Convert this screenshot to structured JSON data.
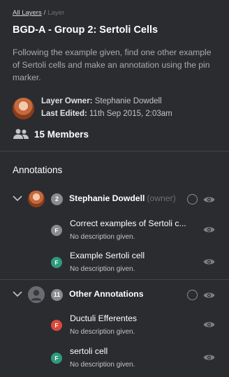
{
  "breadcrumb": {
    "root": "All Layers",
    "separator": "/",
    "current": "Layer"
  },
  "layer": {
    "title": "BGD-A - Group 2: Sertoli Cells",
    "description": "Following the example given, find one other example of Sertoli cells and make an annotation using the pin marker.",
    "owner_label": "Layer Owner:",
    "owner_name": "Stephanie Dowdell",
    "edited_label": "Last Edited:",
    "edited_value": "11th Sep 2015, 2:03am"
  },
  "members": {
    "label": "15 Members",
    "icon": "people-icon"
  },
  "annotations_heading": "Annotations",
  "colors": {
    "background": "#2b2c30",
    "divider": "#44454a",
    "badge_gray": "#8a8b8f",
    "badge_green": "#2e9b7c",
    "badge_red": "#d9493a"
  },
  "groups": [
    {
      "name": "Stephanie Dowdell",
      "role": "(owner)",
      "count": "2",
      "items": [
        {
          "letter": "F",
          "color": "#8a8b8f",
          "title": "Correct examples of Sertoli c...",
          "description": "No description given."
        },
        {
          "letter": "F",
          "color": "#2e9b7c",
          "title": "Example Sertoli cell",
          "description": "No description given."
        }
      ]
    },
    {
      "name": "Other Annotations",
      "role": "",
      "count": "11",
      "items": [
        {
          "letter": "F",
          "color": "#d9493a",
          "title": "Ductuli Efferentes",
          "description": "No description given."
        },
        {
          "letter": "F",
          "color": "#2e9b7c",
          "title": "sertoli cell",
          "description": "No description given."
        }
      ]
    }
  ]
}
